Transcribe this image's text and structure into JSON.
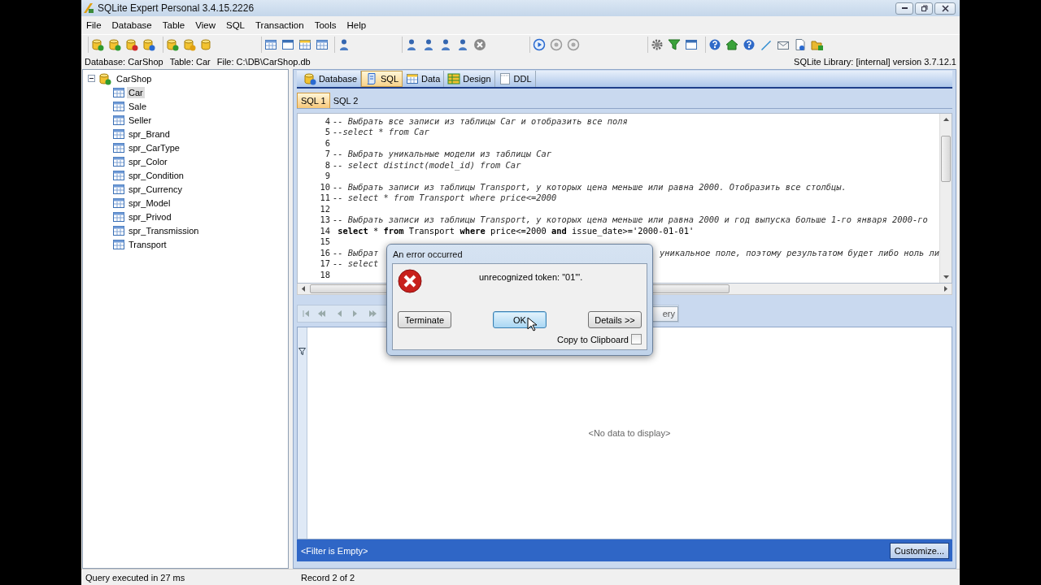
{
  "window": {
    "title": "SQLite Expert Personal 3.4.15.2226"
  },
  "menu": [
    "File",
    "Database",
    "Table",
    "View",
    "SQL",
    "Transaction",
    "Tools",
    "Help"
  ],
  "info_bar": {
    "database": "Database: CarShop",
    "table": "Table: Car",
    "file": "File: C:\\DB\\CarShop.db",
    "library": "SQLite Library: [internal] version 3.7.12.1"
  },
  "tree": {
    "label": "CarShop",
    "expanded": true,
    "children": [
      {
        "label": "Car",
        "selected": true
      },
      {
        "label": "Sale",
        "selected": false
      },
      {
        "label": "Seller",
        "selected": false
      },
      {
        "label": "spr_Brand",
        "selected": false
      },
      {
        "label": "spr_CarType",
        "selected": false
      },
      {
        "label": "spr_Color",
        "selected": false
      },
      {
        "label": "spr_Condition",
        "selected": false
      },
      {
        "label": "spr_Currency",
        "selected": false
      },
      {
        "label": "spr_Model",
        "selected": false
      },
      {
        "label": "spr_Privod",
        "selected": false
      },
      {
        "label": "spr_Transmission",
        "selected": false
      },
      {
        "label": "Transport",
        "selected": false
      }
    ]
  },
  "tabs": [
    {
      "label": "Database",
      "selected": false
    },
    {
      "label": "SQL",
      "selected": true
    },
    {
      "label": "Data",
      "selected": false
    },
    {
      "label": "Design",
      "selected": false
    },
    {
      "label": "DDL",
      "selected": false
    }
  ],
  "sql_tabs": [
    {
      "label": "SQL 1",
      "selected": true
    },
    {
      "label": "SQL 2",
      "selected": false
    }
  ],
  "editor": {
    "lines": [
      {
        "number": "4",
        "kind": "comment",
        "text": "-- Выбрать все записи из таблицы Car и отобразить все поля"
      },
      {
        "number": "5",
        "kind": "comment",
        "text": "--select * from Car"
      },
      {
        "number": "6"
      },
      {
        "number": "7",
        "kind": "comment",
        "text": "-- Выбрать уникальные модели из таблицы Car"
      },
      {
        "number": "8",
        "kind": "comment",
        "text": "-- select distinct(model_id) from Car"
      },
      {
        "number": "9"
      },
      {
        "number": "10",
        "kind": "comment",
        "text": "-- Выбрать записи из таблицы Transport, у которых цена меньше или равна 2000. Отобразить все столбцы."
      },
      {
        "number": "11",
        "kind": "comment",
        "text": "-- select * from Transport where price<=2000"
      },
      {
        "number": "12"
      },
      {
        "number": "13",
        "kind": "comment",
        "text": "-- Выбрать записи из таблицы Transport, у которых цена меньше или равна 2000 и год выпуска больше 1-го января 2000-го"
      },
      {
        "number": "14",
        "kind": "code",
        "text": " **select** * **from** Transport **where** price<=2000 **and** issue_date>='2000-01-01'"
      },
      {
        "number": "15"
      },
      {
        "number": "16",
        "kind": "comment",
        "text": "-- Выбрат",
        "text_after_dialog": "уникальное поле, поэтому результатом будет либо ноль ли"
      },
      {
        "number": "17",
        "kind": "comment",
        "text": "-- select"
      },
      {
        "number": "18"
      }
    ]
  },
  "results": {
    "query_button": "ery",
    "empty_text": "<No data to display>",
    "filter_text": "<Filter is Empty>",
    "customize_button": "Customize..."
  },
  "status_bar": {
    "left": "Query executed in 27 ms",
    "right": "Record 2 of 2"
  },
  "dialog": {
    "title": "An error occurred",
    "message": "unrecognized token: \"01'\".",
    "buttons": [
      {
        "label": "Terminate",
        "default": false
      },
      {
        "label": "OK",
        "default": true
      },
      {
        "label": "Details >>",
        "default": false
      }
    ],
    "checkbox": {
      "label": "Copy to Clipboard",
      "checked": false
    }
  }
}
